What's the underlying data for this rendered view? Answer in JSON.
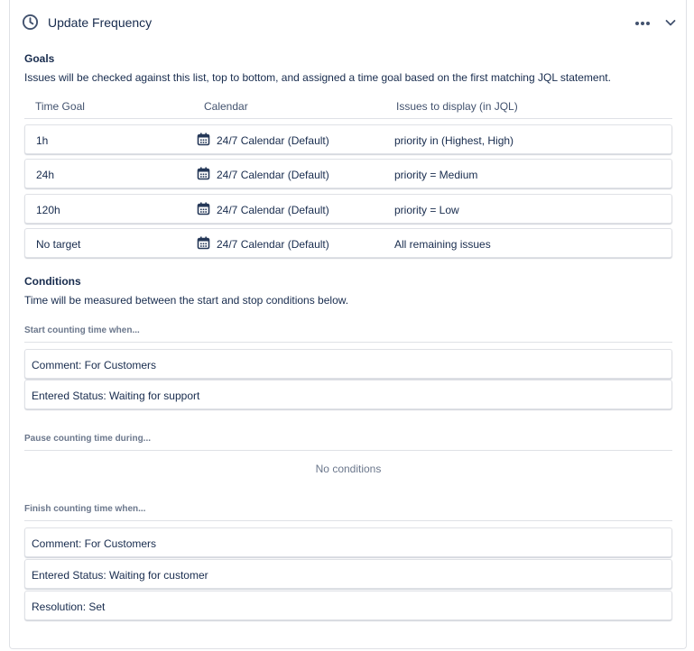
{
  "panel": {
    "title": "Update Frequency",
    "icons": {
      "title": "clock-icon",
      "more": "more-horizontal-icon",
      "expand": "chevron-down-icon"
    }
  },
  "goals": {
    "heading": "Goals",
    "description": "Issues will be checked against this list, top to bottom, and assigned a time goal based on the first matching JQL statement.",
    "columns": {
      "time_goal": "Time Goal",
      "calendar": "Calendar",
      "jql": "Issues to display (in JQL)"
    },
    "rows": [
      {
        "time_goal": "1h",
        "calendar": "24/7 Calendar (Default)",
        "jql": "priority in (Highest, High)"
      },
      {
        "time_goal": "24h",
        "calendar": "24/7 Calendar (Default)",
        "jql": "priority = Medium"
      },
      {
        "time_goal": "120h",
        "calendar": "24/7 Calendar (Default)",
        "jql": "priority = Low"
      },
      {
        "time_goal": "No target",
        "calendar": "24/7 Calendar (Default)",
        "jql": "All remaining issues"
      }
    ],
    "calendar_icon": "calendar-icon"
  },
  "conditions": {
    "heading": "Conditions",
    "description": "Time will be measured between the start and stop conditions below.",
    "start": {
      "label": "Start counting time when...",
      "items": [
        "Comment: For Customers",
        "Entered Status: Waiting for support"
      ]
    },
    "pause": {
      "label": "Pause counting time during...",
      "empty_text": "No conditions"
    },
    "finish": {
      "label": "Finish counting time when...",
      "items": [
        "Comment: For Customers",
        "Entered Status: Waiting for customer",
        "Resolution: Set"
      ]
    }
  },
  "colors": {
    "text": "#172b4d",
    "subtle": "#6b778c",
    "border": "#dfe1e6"
  }
}
